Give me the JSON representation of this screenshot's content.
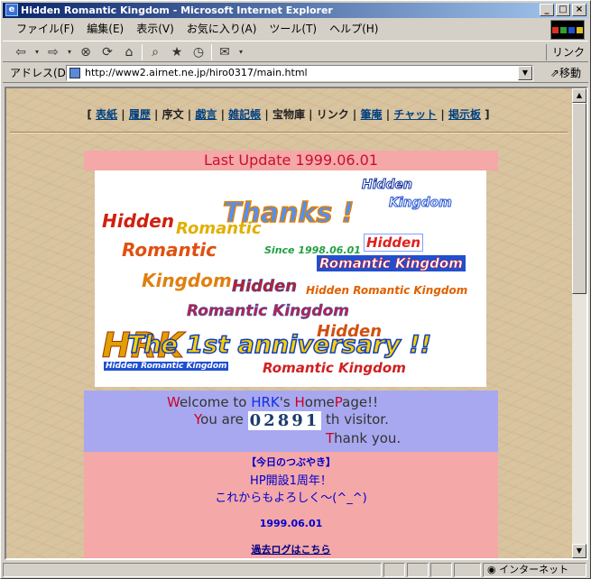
{
  "window": {
    "title": "Hidden Romantic Kingdom - Microsoft Internet Explorer",
    "app_icon_glyph": "e"
  },
  "menu": [
    "ファイル(F)",
    "編集(E)",
    "表示(V)",
    "お気に入り(A)",
    "ツール(T)",
    "ヘルプ(H)"
  ],
  "toolbar": {
    "links_label": "リンク"
  },
  "address": {
    "label": "アドレス(D)",
    "url": "http://www2.airnet.ne.jp/hiro0317/main.html",
    "go_label": "移動"
  },
  "nav": {
    "open": "[",
    "close": "]",
    "sep": "|",
    "items": [
      {
        "label": "表紙",
        "link": true
      },
      {
        "label": "履歴",
        "link": true
      },
      {
        "label": "序文",
        "link": false
      },
      {
        "label": "戯言",
        "link": true
      },
      {
        "label": "雑記帳",
        "link": true
      },
      {
        "label": "宝物庫",
        "link": false
      },
      {
        "label": "リンク",
        "link": false
      },
      {
        "label": "筆庵",
        "link": true
      },
      {
        "label": "チャット",
        "link": true
      },
      {
        "label": "掲示板",
        "link": true
      }
    ]
  },
  "update": "Last Update 1999.06.01",
  "banner": {
    "thanks": "Thanks !",
    "hidden": "Hidden",
    "romantic": "Romantic",
    "kingdom": "Kingdom",
    "romantic_kingdom": "Romantic Kingdom",
    "hidden_romantic_kingdom": "Hidden Romantic Kingdom",
    "since": "Since 1998.06.01",
    "hrk": "HRK",
    "anniversary": "The 1st anniversary !!"
  },
  "welcome": {
    "w_cap": "W",
    "w_rest": "elcome to ",
    "hrk": "HRK",
    "poss": "'s ",
    "h_cap": "H",
    "ome": "ome",
    "p_cap": "P",
    "age": "age!!",
    "y_cap": "Y",
    "you_are": "ou are ",
    "count": "02891",
    "visitor": " th visitor.",
    "t_cap": "T",
    "thank": "hank you."
  },
  "tsubuyaki": {
    "header": "【今日のつぶやき】",
    "line1": "HP開設1周年！",
    "line2": "これからもよろしく～(^_^)",
    "date": "1999.06.01",
    "past_log": "過去ログはこちら"
  },
  "status": {
    "zone": "インターネット"
  },
  "colors": {
    "title_start": "#0a246a",
    "title_end": "#a6caf0",
    "update_bg": "#f4a8a8",
    "welcome_bg": "#a8a8f0",
    "accent_red": "#c8102e"
  }
}
